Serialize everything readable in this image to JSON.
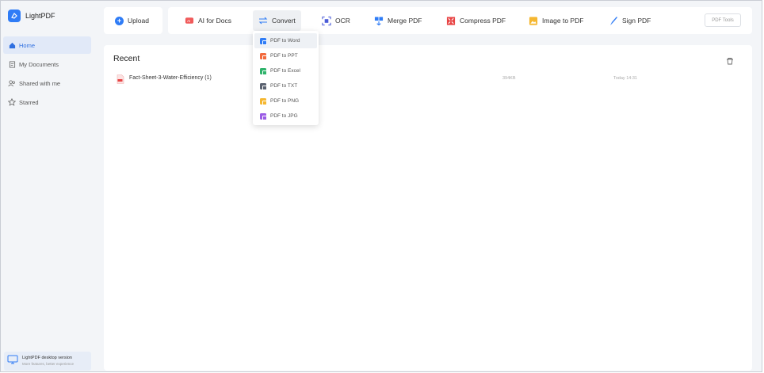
{
  "app": {
    "name": "LightPDF"
  },
  "sidebar": {
    "items": [
      {
        "label": "Home",
        "icon": "home-icon",
        "active": true
      },
      {
        "label": "My Documents",
        "icon": "documents-icon",
        "active": false
      },
      {
        "label": "Shared with me",
        "icon": "shared-icon",
        "active": false
      },
      {
        "label": "Starred",
        "icon": "star-icon",
        "active": false
      }
    ],
    "desktop_promo": {
      "title": "LightPDF desktop version",
      "subtitle": "More features, better experience"
    }
  },
  "toolbar": {
    "upload_label": "Upload",
    "tools": [
      {
        "label": "AI for Docs",
        "icon": "ai-icon"
      },
      {
        "label": "Convert",
        "icon": "convert-icon"
      },
      {
        "label": "OCR",
        "icon": "ocr-icon"
      },
      {
        "label": "Merge PDF",
        "icon": "merge-icon"
      },
      {
        "label": "Compress PDF",
        "icon": "compress-icon"
      },
      {
        "label": "Image to PDF",
        "icon": "image-icon"
      },
      {
        "label": "Sign PDF",
        "icon": "sign-icon"
      }
    ],
    "pdf_tools_label": "PDF Tools"
  },
  "convert_menu": {
    "items": [
      {
        "label": "PDF to Word",
        "color": "#2f7cf6"
      },
      {
        "label": "PDF to PPT",
        "color": "#f26a3d"
      },
      {
        "label": "PDF to Excel",
        "color": "#2fb36b"
      },
      {
        "label": "PDF to TXT",
        "color": "#5b6270"
      },
      {
        "label": "PDF to PNG",
        "color": "#f5b731"
      },
      {
        "label": "PDF to JPG",
        "color": "#9b5de5"
      }
    ]
  },
  "main": {
    "title": "Recent",
    "files": [
      {
        "name": "Fact-Sheet-3-Water-Efficiency (1)",
        "size": "394KB",
        "time": "Today 14:31"
      }
    ]
  },
  "colors": {
    "accent": "#2f7cf6",
    "pdf_red": "#e84545"
  }
}
